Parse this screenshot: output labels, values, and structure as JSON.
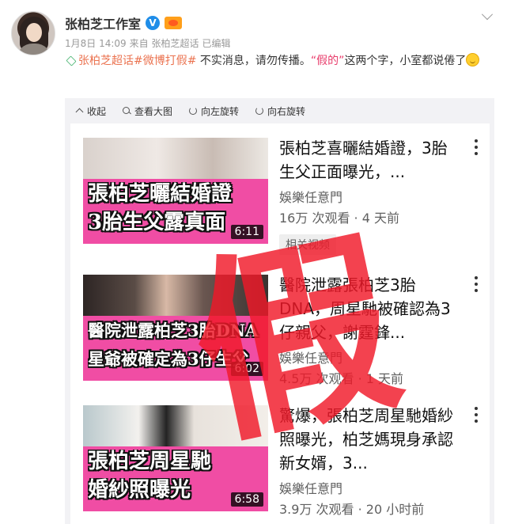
{
  "post": {
    "username": "张柏芝工作室",
    "verified_mark": "V",
    "meta": [
      "1月8日 14:09",
      "来自 张柏芝超话",
      "已编辑"
    ],
    "content": {
      "topic1": "张柏芝超话",
      "topic2": "#微博打假#",
      "text1": " 不实消息，请勿传播。",
      "quote": "“假的”",
      "text2": "这两个字，小室都说倦了"
    }
  },
  "toolbar": {
    "collapse": "收起",
    "view_large": "查看大图",
    "rotate_left": "向左旋转",
    "rotate_right": "向右旋转"
  },
  "videos": [
    {
      "title": "張柏芝喜曬結婚證，3胎生父正面曝光，...",
      "channel": "娛樂任意門",
      "stats": "16万 次观看 · 4 天前",
      "duration": "6:11",
      "caption1": "張柏芝曬結婚證",
      "caption2": "3胎生父露真面",
      "related_tag": "相关视频"
    },
    {
      "title": "醫院泄露張柏芝3胎DNA，周星馳被確認為3仔親父，謝霆鋒...",
      "channel": "娛樂任意門",
      "stats": "4.5万 次观看 · 1 天前",
      "duration": "6:02",
      "caption1": "醫院泄露柏芝3胎DNA",
      "caption2": "星爺被確定為3仔生父"
    },
    {
      "title": "驚爆，張柏芝周星馳婚紗照曝光，柏芝媽現身承認新女婿，3...",
      "channel": "娛樂任意門",
      "stats": "3.9万 次观看 · 20 小时前",
      "duration": "6:58",
      "caption1": "張柏芝周星馳",
      "caption2": "婚紗照曝光"
    }
  ],
  "stamp": "假",
  "colors": {
    "link": "#eb7350",
    "quote": "#e83c6b",
    "stamp": "#f01828",
    "thumb_band": "#f04da4",
    "verified": "#1f8de8"
  }
}
